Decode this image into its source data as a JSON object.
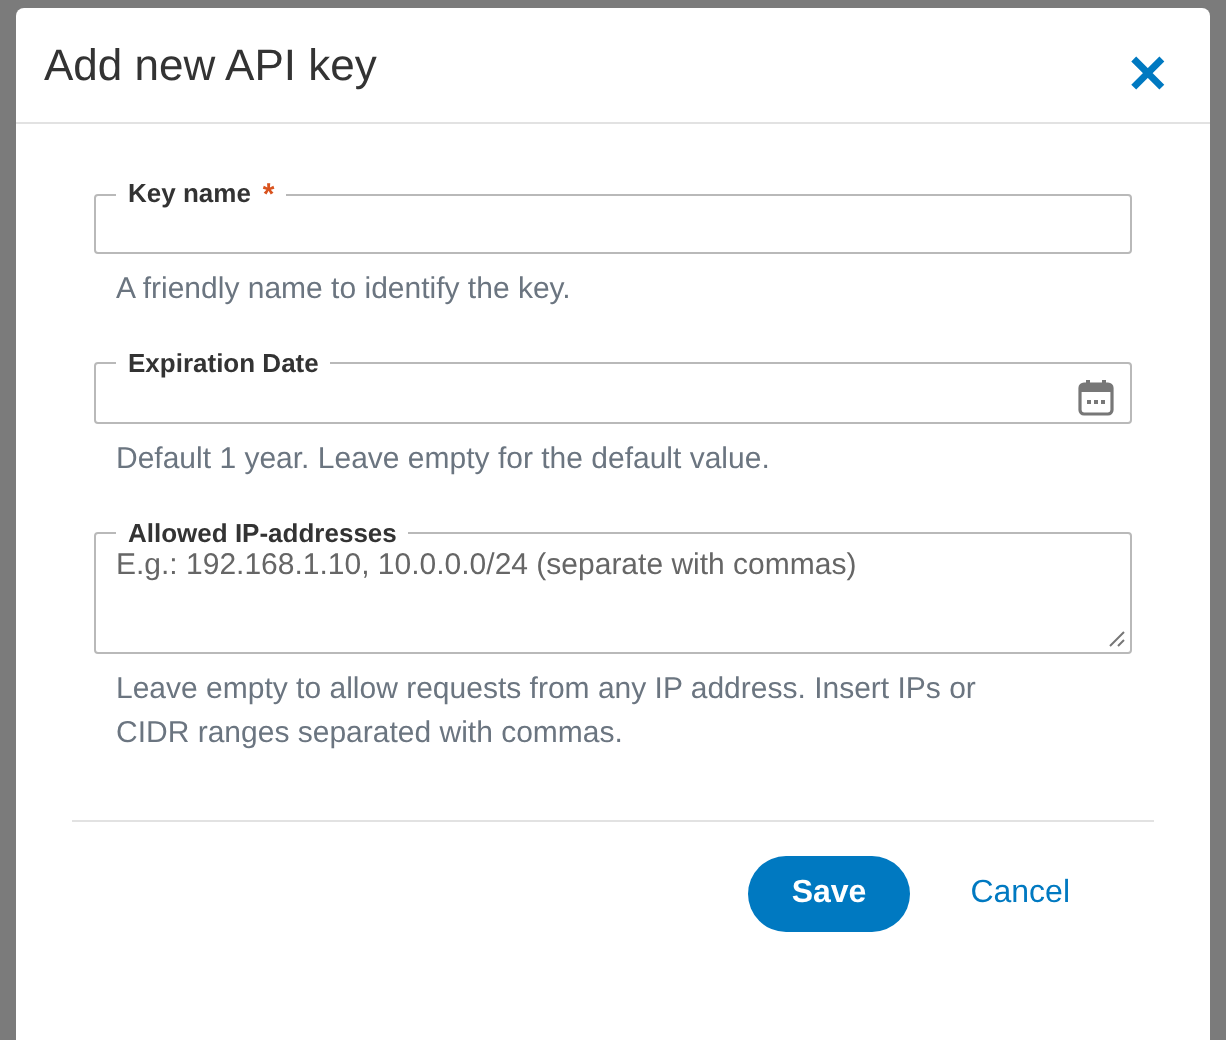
{
  "dialog": {
    "title": "Add new API key",
    "close_icon": "✕"
  },
  "fields": [
    {
      "kind": "text",
      "label": "Key name",
      "required_mark": "*",
      "hint": "A friendly name to identify the key."
    },
    {
      "kind": "date",
      "label": "Expiration Date",
      "hint": "Default 1 year. Leave empty for the default value."
    },
    {
      "kind": "textarea",
      "label": "Allowed IP-addresses",
      "placeholder": "E.g.: 192.168.1.10, 10.0.0.0/24 (separate with commas)",
      "hint": "Leave empty to allow requests from any IP address. Insert IPs or CIDR ranges separated with commas."
    }
  ],
  "buttons": [
    {
      "kind": "primary",
      "label": "Save"
    },
    {
      "kind": "link",
      "label": "Cancel"
    }
  ]
}
